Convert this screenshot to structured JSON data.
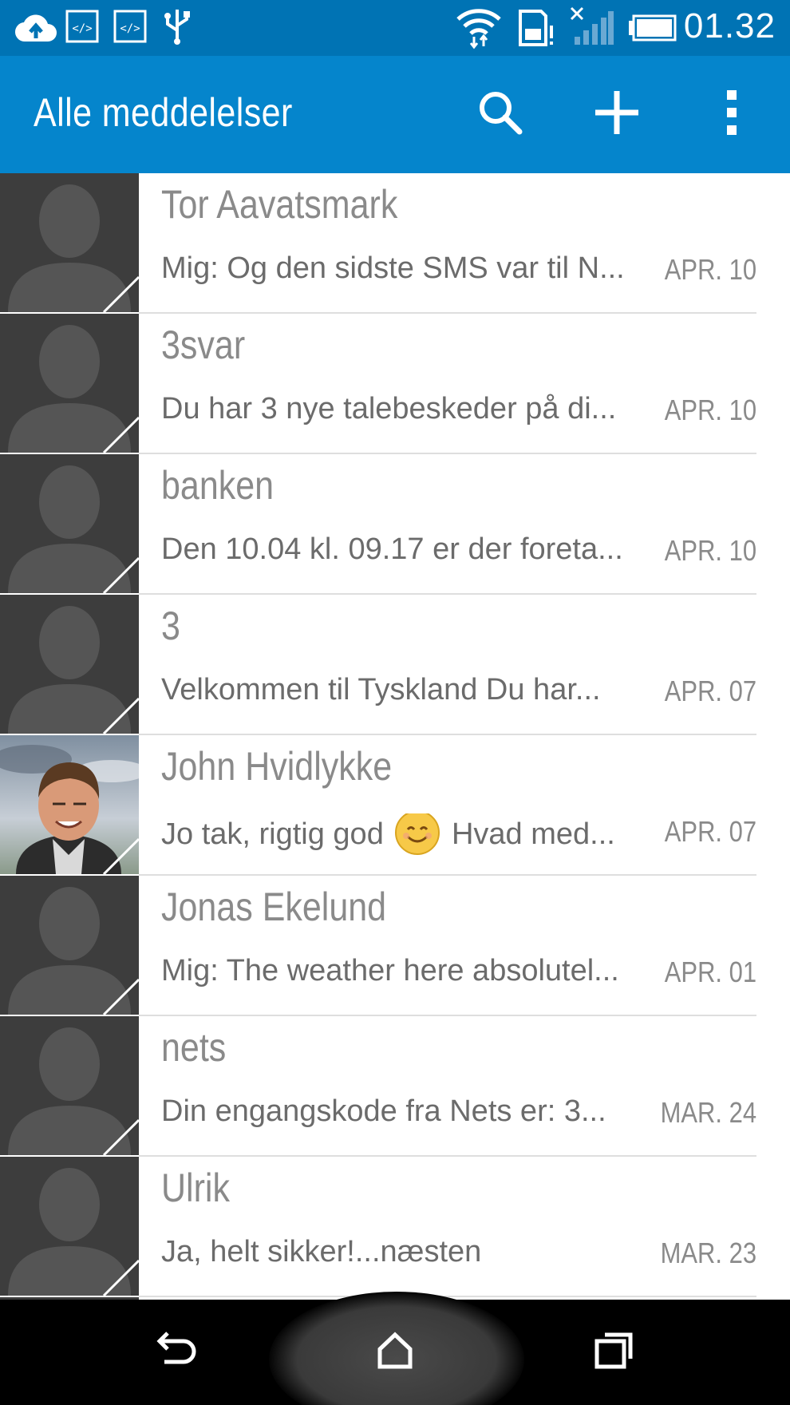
{
  "status_bar": {
    "time": "01.32",
    "icons": [
      "cloud-upload-icon",
      "code-icon",
      "code-icon",
      "usb-icon",
      "wifi-icon",
      "sim-alert-icon",
      "signal-no-service-icon",
      "battery-full-icon"
    ]
  },
  "app_bar": {
    "title": "Alle meddelelser",
    "actions": [
      "search-icon",
      "add-icon",
      "overflow-menu-icon"
    ]
  },
  "conversations": [
    {
      "name": "Tor Aavatsmark",
      "snippet": "Mig: Og den sidste SMS var til N...",
      "date": "APR. 10",
      "avatar": "placeholder"
    },
    {
      "name": "3svar",
      "snippet": "Du har 3 nye talebeskeder på di...",
      "date": "APR. 10",
      "avatar": "placeholder"
    },
    {
      "name": "banken",
      "snippet": "Den 10.04 kl. 09.17 er der foreta...",
      "date": "APR. 10",
      "avatar": "placeholder"
    },
    {
      "name": "3",
      "snippet": "Velkommen til Tyskland Du har...",
      "date": "APR. 07",
      "avatar": "placeholder"
    },
    {
      "name": "John Hvidlykke",
      "snippet_before": "Jo tak, rigtig god",
      "snippet_after": "Hvad med...",
      "date": "APR. 07",
      "avatar": "photo"
    },
    {
      "name": "Jonas Ekelund",
      "snippet": "Mig: The weather here absolutel...",
      "date": "APR. 01",
      "avatar": "placeholder"
    },
    {
      "name": "nets",
      "snippet": "Din engangskode fra Nets er: 3...",
      "date": "MAR. 24",
      "avatar": "placeholder"
    },
    {
      "name": "Ulrik",
      "snippet": "Ja, helt sikker!...næsten",
      "date": "MAR. 23",
      "avatar": "placeholder"
    }
  ],
  "nav_bar": {
    "buttons": [
      "back-icon",
      "home-icon",
      "recent-apps-icon"
    ]
  },
  "colors": {
    "status_bar": "#0073b4",
    "app_bar": "#0585cc",
    "avatar_bg": "#3d3d3d",
    "name_text": "#8a8a8a",
    "snippet_text": "#6b6b6b"
  }
}
